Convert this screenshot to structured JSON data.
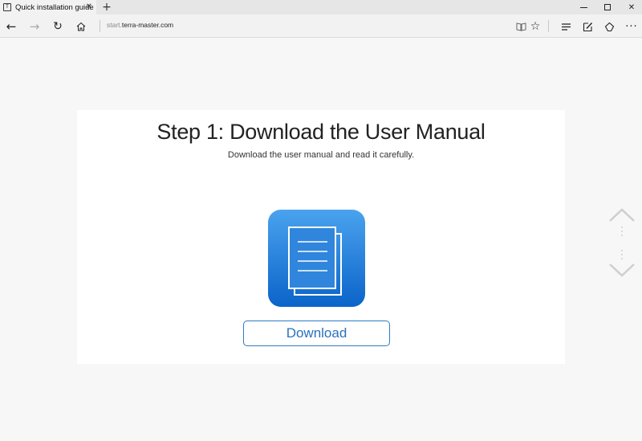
{
  "browser": {
    "tab": {
      "favicon_glyph": "T",
      "title": "Quick installation guide",
      "close_glyph": "✕"
    },
    "new_tab_glyph": "+",
    "window_controls": {
      "close_glyph": "✕"
    },
    "address": {
      "prefix": "start.",
      "host": "terra-master.com"
    },
    "icons": {
      "back": "←",
      "forward": "→",
      "refresh": "↻",
      "star": "☆",
      "more": "···"
    }
  },
  "page": {
    "title": "Step 1: Download the User Manual",
    "subtitle": "Download the user manual and read it carefully.",
    "download_label": "Download",
    "accent_color": "#2a72bd",
    "icon_gradient": [
      "#4aa3ee",
      "#0b64c9"
    ]
  }
}
